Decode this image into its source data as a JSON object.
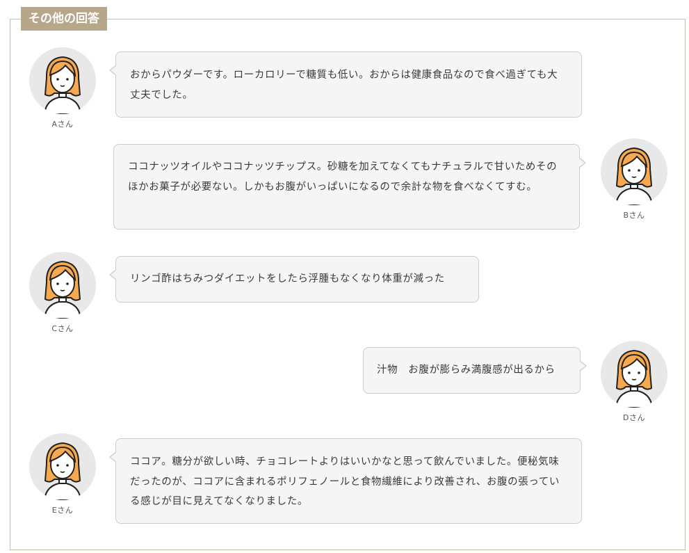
{
  "section": {
    "title": "その他の回答"
  },
  "colors": {
    "title_bg": "#b6a78b",
    "border": "#c9bfa5",
    "bubble_bg": "#f5f5f5",
    "hair": "#f6a94e"
  },
  "answers": [
    {
      "name": "Aさん",
      "side": "left",
      "avatar_icon": "woman-avatar-icon",
      "text": "おからパウダーです。ローカロリーで糖質も低い。おからは健康食品なので食べ過ぎても大丈夫でした。"
    },
    {
      "name": "Bさん",
      "side": "right",
      "avatar_icon": "woman-avatar-icon",
      "text": "ココナッツオイルやココナッツチップス。砂糖を加えてなくてもナチュラルで甘いためそのほかお菓子が必要ない。しかもお腹がいっぱいになるので余計な物を食べなくてすむ。"
    },
    {
      "name": "Cさん",
      "side": "left",
      "avatar_icon": "woman-avatar-icon",
      "text": "リンゴ酢はちみつダイエットをしたら浮腫もなくなり体重が減った"
    },
    {
      "name": "Dさん",
      "side": "right",
      "avatar_icon": "woman-avatar-icon",
      "text": "汁物　お腹が膨らみ満腹感が出るから"
    },
    {
      "name": "Eさん",
      "side": "left",
      "avatar_icon": "woman-avatar-icon",
      "text": "ココア。糖分が欲しい時、チョコレートよりはいいかなと思って飲んでいました。便秘気味だったのが、ココアに含まれるポリフェノールと食物繊維により改善され、お腹の張っている感じが目に見えてなくなりました。"
    }
  ]
}
